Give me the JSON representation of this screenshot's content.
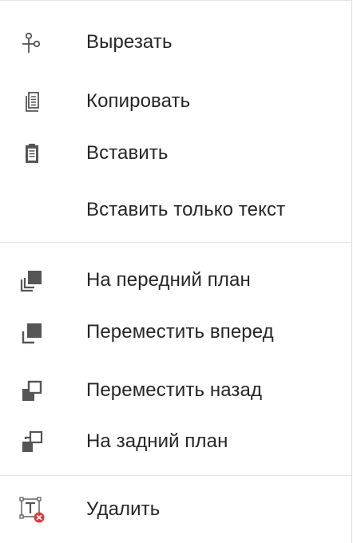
{
  "menu": {
    "items": [
      {
        "label": "Вырезать",
        "icon": "scissors-icon"
      },
      {
        "label": "Копировать",
        "icon": "copy-icon"
      },
      {
        "label": "Вставить",
        "icon": "paste-icon"
      },
      {
        "label": "Вставить только текст",
        "icon": ""
      },
      {
        "label": "На передний план",
        "icon": "bring-to-front-icon"
      },
      {
        "label": "Переместить вперед",
        "icon": "bring-forward-icon"
      },
      {
        "label": "Переместить назад",
        "icon": "send-backward-icon"
      },
      {
        "label": "На задний план",
        "icon": "send-to-back-icon"
      },
      {
        "label": "Удалить",
        "icon": "delete-text-box-icon"
      }
    ]
  },
  "colors": {
    "icon": "#555555",
    "text": "#262626",
    "divider": "#e3e3e3",
    "delete_badge": "#e53935"
  }
}
